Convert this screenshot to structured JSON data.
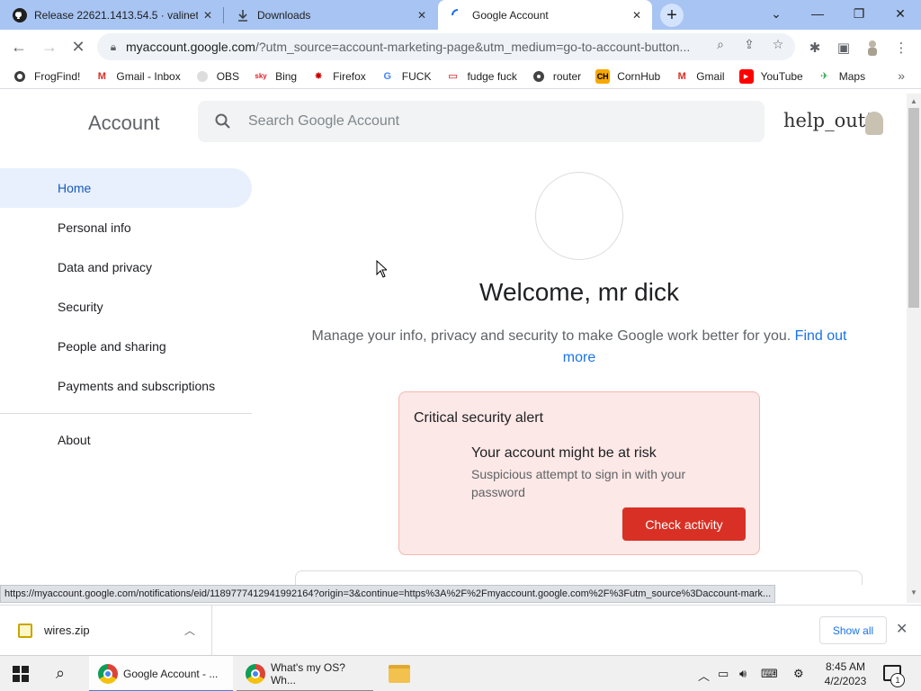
{
  "browser": {
    "tabs": [
      {
        "title": "Release 22621.1413.54.5 · valinet",
        "icon": "github-icon",
        "active": false
      },
      {
        "title": "Downloads",
        "icon": "download-icon",
        "active": false
      },
      {
        "title": "Google Account",
        "icon": "loading-spinner-icon",
        "active": true
      }
    ],
    "url_host": "myaccount.google.com",
    "url_path": "/?utm_source=account-marketing-page&utm_medium=go-to-account-button...",
    "bookmarks": [
      {
        "label": "FrogFind!",
        "icon": "frogfind-icon"
      },
      {
        "label": "Gmail - Inbox",
        "icon": "gmail-icon"
      },
      {
        "label": "OBS",
        "icon": "obs-icon"
      },
      {
        "label": "Bing",
        "icon": "bing-icon"
      },
      {
        "label": "Firefox",
        "icon": "firefox-icon"
      },
      {
        "label": "FUCK",
        "icon": "google-icon"
      },
      {
        "label": "fudge fuck",
        "icon": "fudge-icon"
      },
      {
        "label": "router",
        "icon": "router-icon"
      },
      {
        "label": "CornHub",
        "icon": "cornhub-icon"
      },
      {
        "label": "Gmail",
        "icon": "gmail-icon"
      },
      {
        "label": "YouTube",
        "icon": "youtube-icon"
      },
      {
        "label": "Maps",
        "icon": "maps-icon"
      }
    ]
  },
  "account": {
    "title": "Account",
    "search_placeholder": "Search Google Account",
    "logo_text": "help_out!",
    "nav": [
      {
        "label": "Home",
        "selected": true
      },
      {
        "label": "Personal info",
        "selected": false
      },
      {
        "label": "Data and privacy",
        "selected": false
      },
      {
        "label": "Security",
        "selected": false
      },
      {
        "label": "People and sharing",
        "selected": false
      },
      {
        "label": "Payments and subscriptions",
        "selected": false
      }
    ],
    "nav_about": "About",
    "welcome": "Welcome, mr dick",
    "subtitle": "Manage your info, privacy and security to make Google work better for you.",
    "subtitle_link": "Find out more",
    "alert": {
      "title": "Critical security alert",
      "heading": "Your account might be at risk",
      "body": "Suspicious attempt to sign in with your password",
      "button": "Check activity",
      "color": "#d93025"
    }
  },
  "status_url": "https://myaccount.google.com/notifications/eid/1189777412941992164?origin=3&continue=https%3A%2F%2Fmyaccount.google.com%2F%3Futm_source%3Daccount-mark...",
  "downloads": {
    "file": "wires.zip",
    "show_all": "Show all"
  },
  "taskbar": {
    "tasks": [
      "Google Account - ...",
      "What's my OS? Wh..."
    ],
    "time": "8:45 AM",
    "date": "4/2/2023",
    "notifications": "1"
  }
}
